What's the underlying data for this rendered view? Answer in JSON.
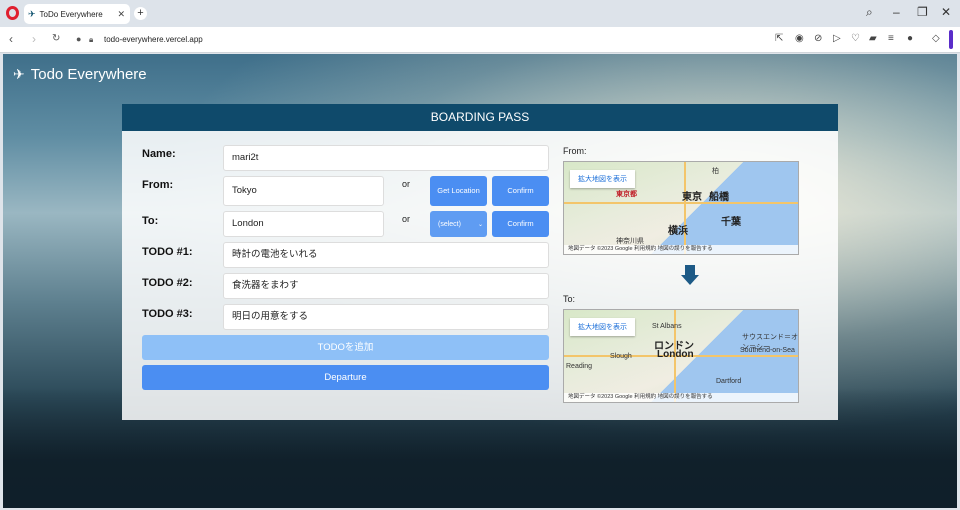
{
  "browser": {
    "tab_title": "ToDo Everywhere",
    "url_domain": "todo-everywhere.vercel.app"
  },
  "app": {
    "brand": "Todo Everywhere"
  },
  "card": {
    "heading": "BOARDING PASS",
    "name_label": "Name:",
    "name_value": "mari2t",
    "from_label": "From:",
    "from_value": "Tokyo",
    "to_label": "To:",
    "to_value": "London",
    "or_text": "or",
    "get_location_label": "Get Location",
    "confirm_label": "Confirm",
    "select_value": "(select)",
    "todos": [
      {
        "label": "TODO #1:",
        "value": "時計の電池をいれる"
      },
      {
        "label": "TODO #2:",
        "value": "食洗器をまわす"
      },
      {
        "label": "TODO #3:",
        "value": "明日の用意をする"
      }
    ],
    "add_todo_label": "TODOを追加",
    "departure_label": "Departure"
  },
  "maps": {
    "from_label": "From:",
    "to_label": "To:",
    "enlarge_label": "拡大地図を表示",
    "from_places": [
      "東京",
      "船橋",
      "千葉",
      "横浜",
      "東京都",
      "神奈川県",
      "柏"
    ],
    "to_places": [
      "ロンドン",
      "London",
      "St Albans",
      "Slough",
      "Reading",
      "Dartford",
      "サウスエンド＝オン＝シー",
      "Southend-on-Sea"
    ],
    "from_footer": "地図データ ©2023 Google  利用規約  地図の誤りを報告する",
    "to_footer": "地図データ ©2023 Google  利用規約  地図の誤りを報告する"
  }
}
